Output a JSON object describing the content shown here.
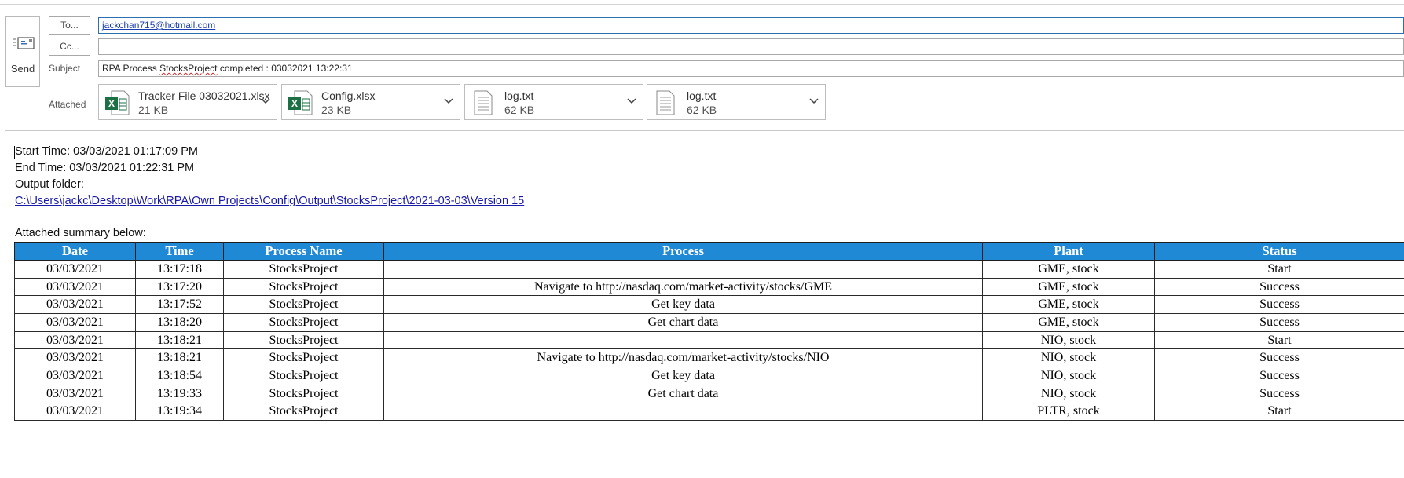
{
  "compose": {
    "send_label": "Send",
    "to_button": "To...",
    "cc_button": "Cc...",
    "subject_label": "Subject",
    "to_value": "jackchan715@hotmail.com",
    "cc_value": "",
    "subject_prefix": "RPA Process ",
    "subject_misspelled": "StocksProject",
    "subject_suffix": " completed : 03032021 13:22:31",
    "attached_label": "Attached"
  },
  "attachments": [
    {
      "name": "Tracker File 03032021.xlsx",
      "size": "21 KB",
      "icon": "excel-file-icon"
    },
    {
      "name": "Config.xlsx",
      "size": "23 KB",
      "icon": "excel-file-icon"
    },
    {
      "name": "log.txt",
      "size": "62 KB",
      "icon": "text-file-icon"
    },
    {
      "name": "log.txt",
      "size": "62 KB",
      "icon": "text-file-icon"
    }
  ],
  "body": {
    "start_time": "Start Time: 03/03/2021 01:17:09 PM",
    "end_time": "End Time: 03/03/2021 01:22:31 PM",
    "output_folder_label": "Output folder:",
    "output_folder_path": "C:\\Users\\jackc\\Desktop\\Work\\RPA\\Own Projects\\Config\\Output\\StocksProject\\2021-03-03\\Version 15",
    "summary_label": "Attached summary below:"
  },
  "table": {
    "headers": [
      "Date",
      "Time",
      "Process Name",
      "Process",
      "Plant",
      "Status"
    ],
    "rows": [
      [
        "03/03/2021",
        "13:17:18",
        "StocksProject",
        "",
        "GME, stock",
        "Start"
      ],
      [
        "03/03/2021",
        "13:17:20",
        "StocksProject",
        "Navigate to http://nasdaq.com/market-activity/stocks/GME",
        "GME, stock",
        "Success"
      ],
      [
        "03/03/2021",
        "13:17:52",
        "StocksProject",
        "Get key data",
        "GME, stock",
        "Success"
      ],
      [
        "03/03/2021",
        "13:18:20",
        "StocksProject",
        "Get chart data",
        "GME, stock",
        "Success"
      ],
      [
        "03/03/2021",
        "13:18:21",
        "StocksProject",
        "",
        "NIO, stock",
        "Start"
      ],
      [
        "03/03/2021",
        "13:18:21",
        "StocksProject",
        "Navigate to http://nasdaq.com/market-activity/stocks/NIO",
        "NIO, stock",
        "Success"
      ],
      [
        "03/03/2021",
        "13:18:54",
        "StocksProject",
        "Get key data",
        "NIO, stock",
        "Success"
      ],
      [
        "03/03/2021",
        "13:19:33",
        "StocksProject",
        "Get chart data",
        "NIO, stock",
        "Success"
      ],
      [
        "03/03/2021",
        "13:19:34",
        "StocksProject",
        "",
        "PLTR, stock",
        "Start"
      ]
    ]
  },
  "colors": {
    "table_header_bg": "#2089d6",
    "link": "#1a1aa8",
    "excel_green": "#1d7044"
  }
}
